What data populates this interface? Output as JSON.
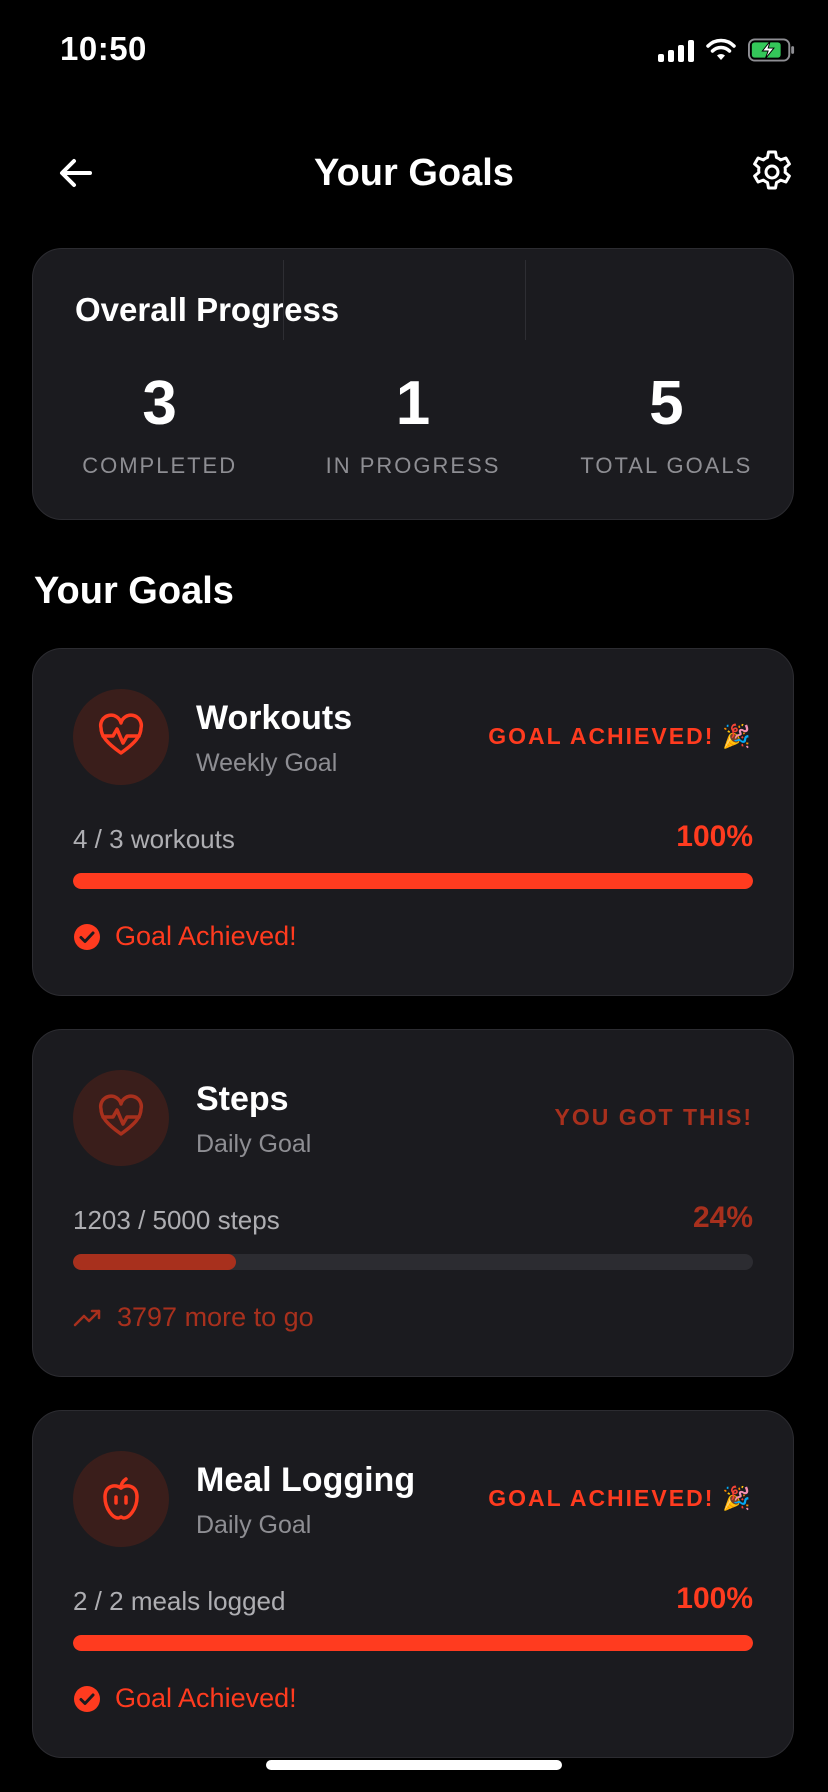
{
  "status_bar": {
    "time": "10:50"
  },
  "nav": {
    "title": "Your Goals",
    "back_icon": "arrow-left-icon",
    "settings_icon": "gear-icon"
  },
  "overall": {
    "title": "Overall Progress",
    "stats": [
      {
        "value": "3",
        "label": "COMPLETED"
      },
      {
        "value": "1",
        "label": "IN PROGRESS"
      },
      {
        "value": "5",
        "label": "TOTAL GOALS"
      }
    ]
  },
  "section_title": "Your Goals",
  "goals": [
    {
      "name": "Workouts",
      "period": "Weekly Goal",
      "icon": "heart-pulse-icon",
      "status": "GOAL ACHIEVED!",
      "status_emoji": "🎉",
      "progress_text": "4 / 3 workouts",
      "percent": "100%",
      "progress": 1.0,
      "footer": "Goal Achieved!",
      "footer_icon": "check-circle-icon",
      "achieved": true
    },
    {
      "name": "Steps",
      "period": "Daily Goal",
      "icon": "heart-pulse-icon",
      "status": "YOU GOT THIS!",
      "status_emoji": "",
      "progress_text": "1203 / 5000 steps",
      "percent": "24%",
      "progress": 0.24,
      "footer": "3797 more to go",
      "footer_icon": "trending-up-icon",
      "achieved": false
    },
    {
      "name": "Meal Logging",
      "period": "Daily Goal",
      "icon": "apple-icon",
      "status": "GOAL ACHIEVED!",
      "status_emoji": "🎉",
      "progress_text": "2 / 2 meals logged",
      "percent": "100%",
      "progress": 1.0,
      "footer": "Goal Achieved!",
      "footer_icon": "check-circle-icon",
      "achieved": true
    }
  ],
  "colors": {
    "accent": "#ff3b1f",
    "accent_dim": "#a8301d",
    "card": "#1b1b1f",
    "muted": "#8e8e93"
  }
}
